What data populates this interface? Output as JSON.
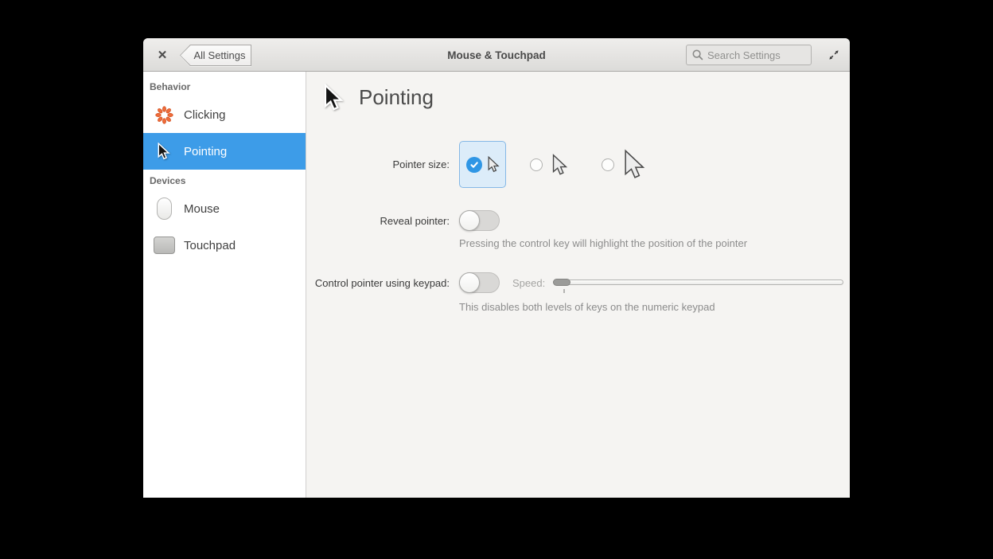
{
  "window": {
    "back_button": "All Settings",
    "title": "Mouse & Touchpad",
    "search_placeholder": "Search Settings"
  },
  "icons": {
    "close": "✕",
    "search": "magnifier",
    "expand": "diagonal-resize-arrows",
    "clicking": "orange-starburst",
    "pointing": "black-arrow-cursor",
    "mouse": "mouse-shape",
    "touchpad": "touchpad-shape"
  },
  "sidebar": {
    "sections": [
      {
        "label": "Behavior",
        "items": [
          {
            "label": "Clicking",
            "selected": false
          },
          {
            "label": "Pointing",
            "selected": true
          }
        ]
      },
      {
        "label": "Devices",
        "items": [
          {
            "label": "Mouse",
            "selected": false
          },
          {
            "label": "Touchpad",
            "selected": false
          }
        ]
      }
    ]
  },
  "main": {
    "title": "Pointing",
    "pointer_size": {
      "label": "Pointer size:",
      "options": [
        {
          "size": "small",
          "selected": true
        },
        {
          "size": "medium",
          "selected": false
        },
        {
          "size": "large",
          "selected": false
        }
      ]
    },
    "reveal_pointer": {
      "label": "Reveal pointer:",
      "enabled": false,
      "help": "Pressing the control key will highlight the position of the pointer"
    },
    "keypad": {
      "label": "Control pointer using keypad:",
      "enabled": false,
      "speed_label": "Speed:",
      "speed_value": 0,
      "help": "This disables both levels of keys on the numeric keypad"
    }
  },
  "colors": {
    "accent_blue": "#3d9ce8",
    "selected_option_bg": "#dcecf9",
    "selected_option_border": "#85b8e6",
    "header_gradient_top": "#efeeec",
    "header_gradient_bottom": "#dcdbd9",
    "sidebar_bg": "#ffffff",
    "content_bg": "#f5f4f2",
    "clicking_icon_orange": "#ef6c3a"
  }
}
